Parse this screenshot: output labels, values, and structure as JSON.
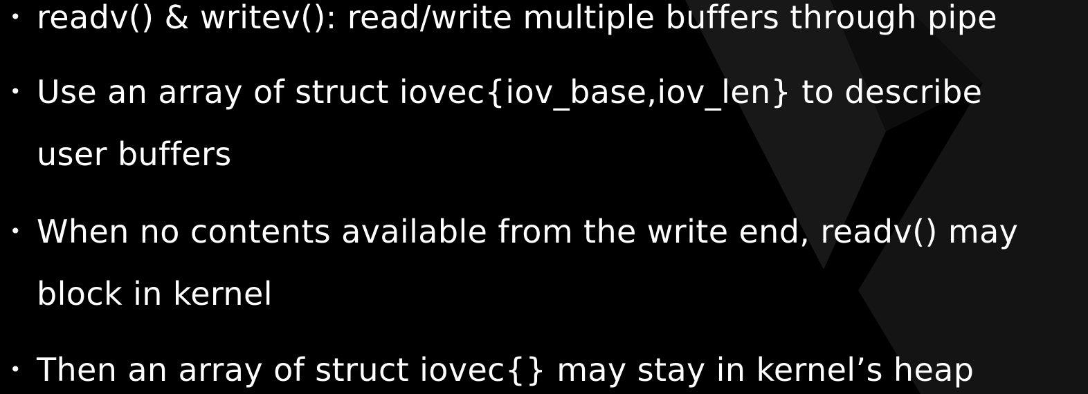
{
  "slide": {
    "bullets": [
      {
        "lines": [
          "readv() & writev(): read/write multiple buffers through pipe"
        ]
      },
      {
        "lines": [
          "Use an array of struct iovec{iov_base,iov_len} to describe",
          "user buffers"
        ]
      },
      {
        "lines": [
          "When no contents available from the write end, readv() may",
          "block in kernel"
        ]
      },
      {
        "lines": [
          "Then an array of struct iovec{} may stay in kernel’s heap"
        ]
      }
    ],
    "bullet_symbol": "•",
    "colors": {
      "background": "#000000",
      "text": "#ffffff",
      "decoration": "#1a1a1a"
    }
  }
}
